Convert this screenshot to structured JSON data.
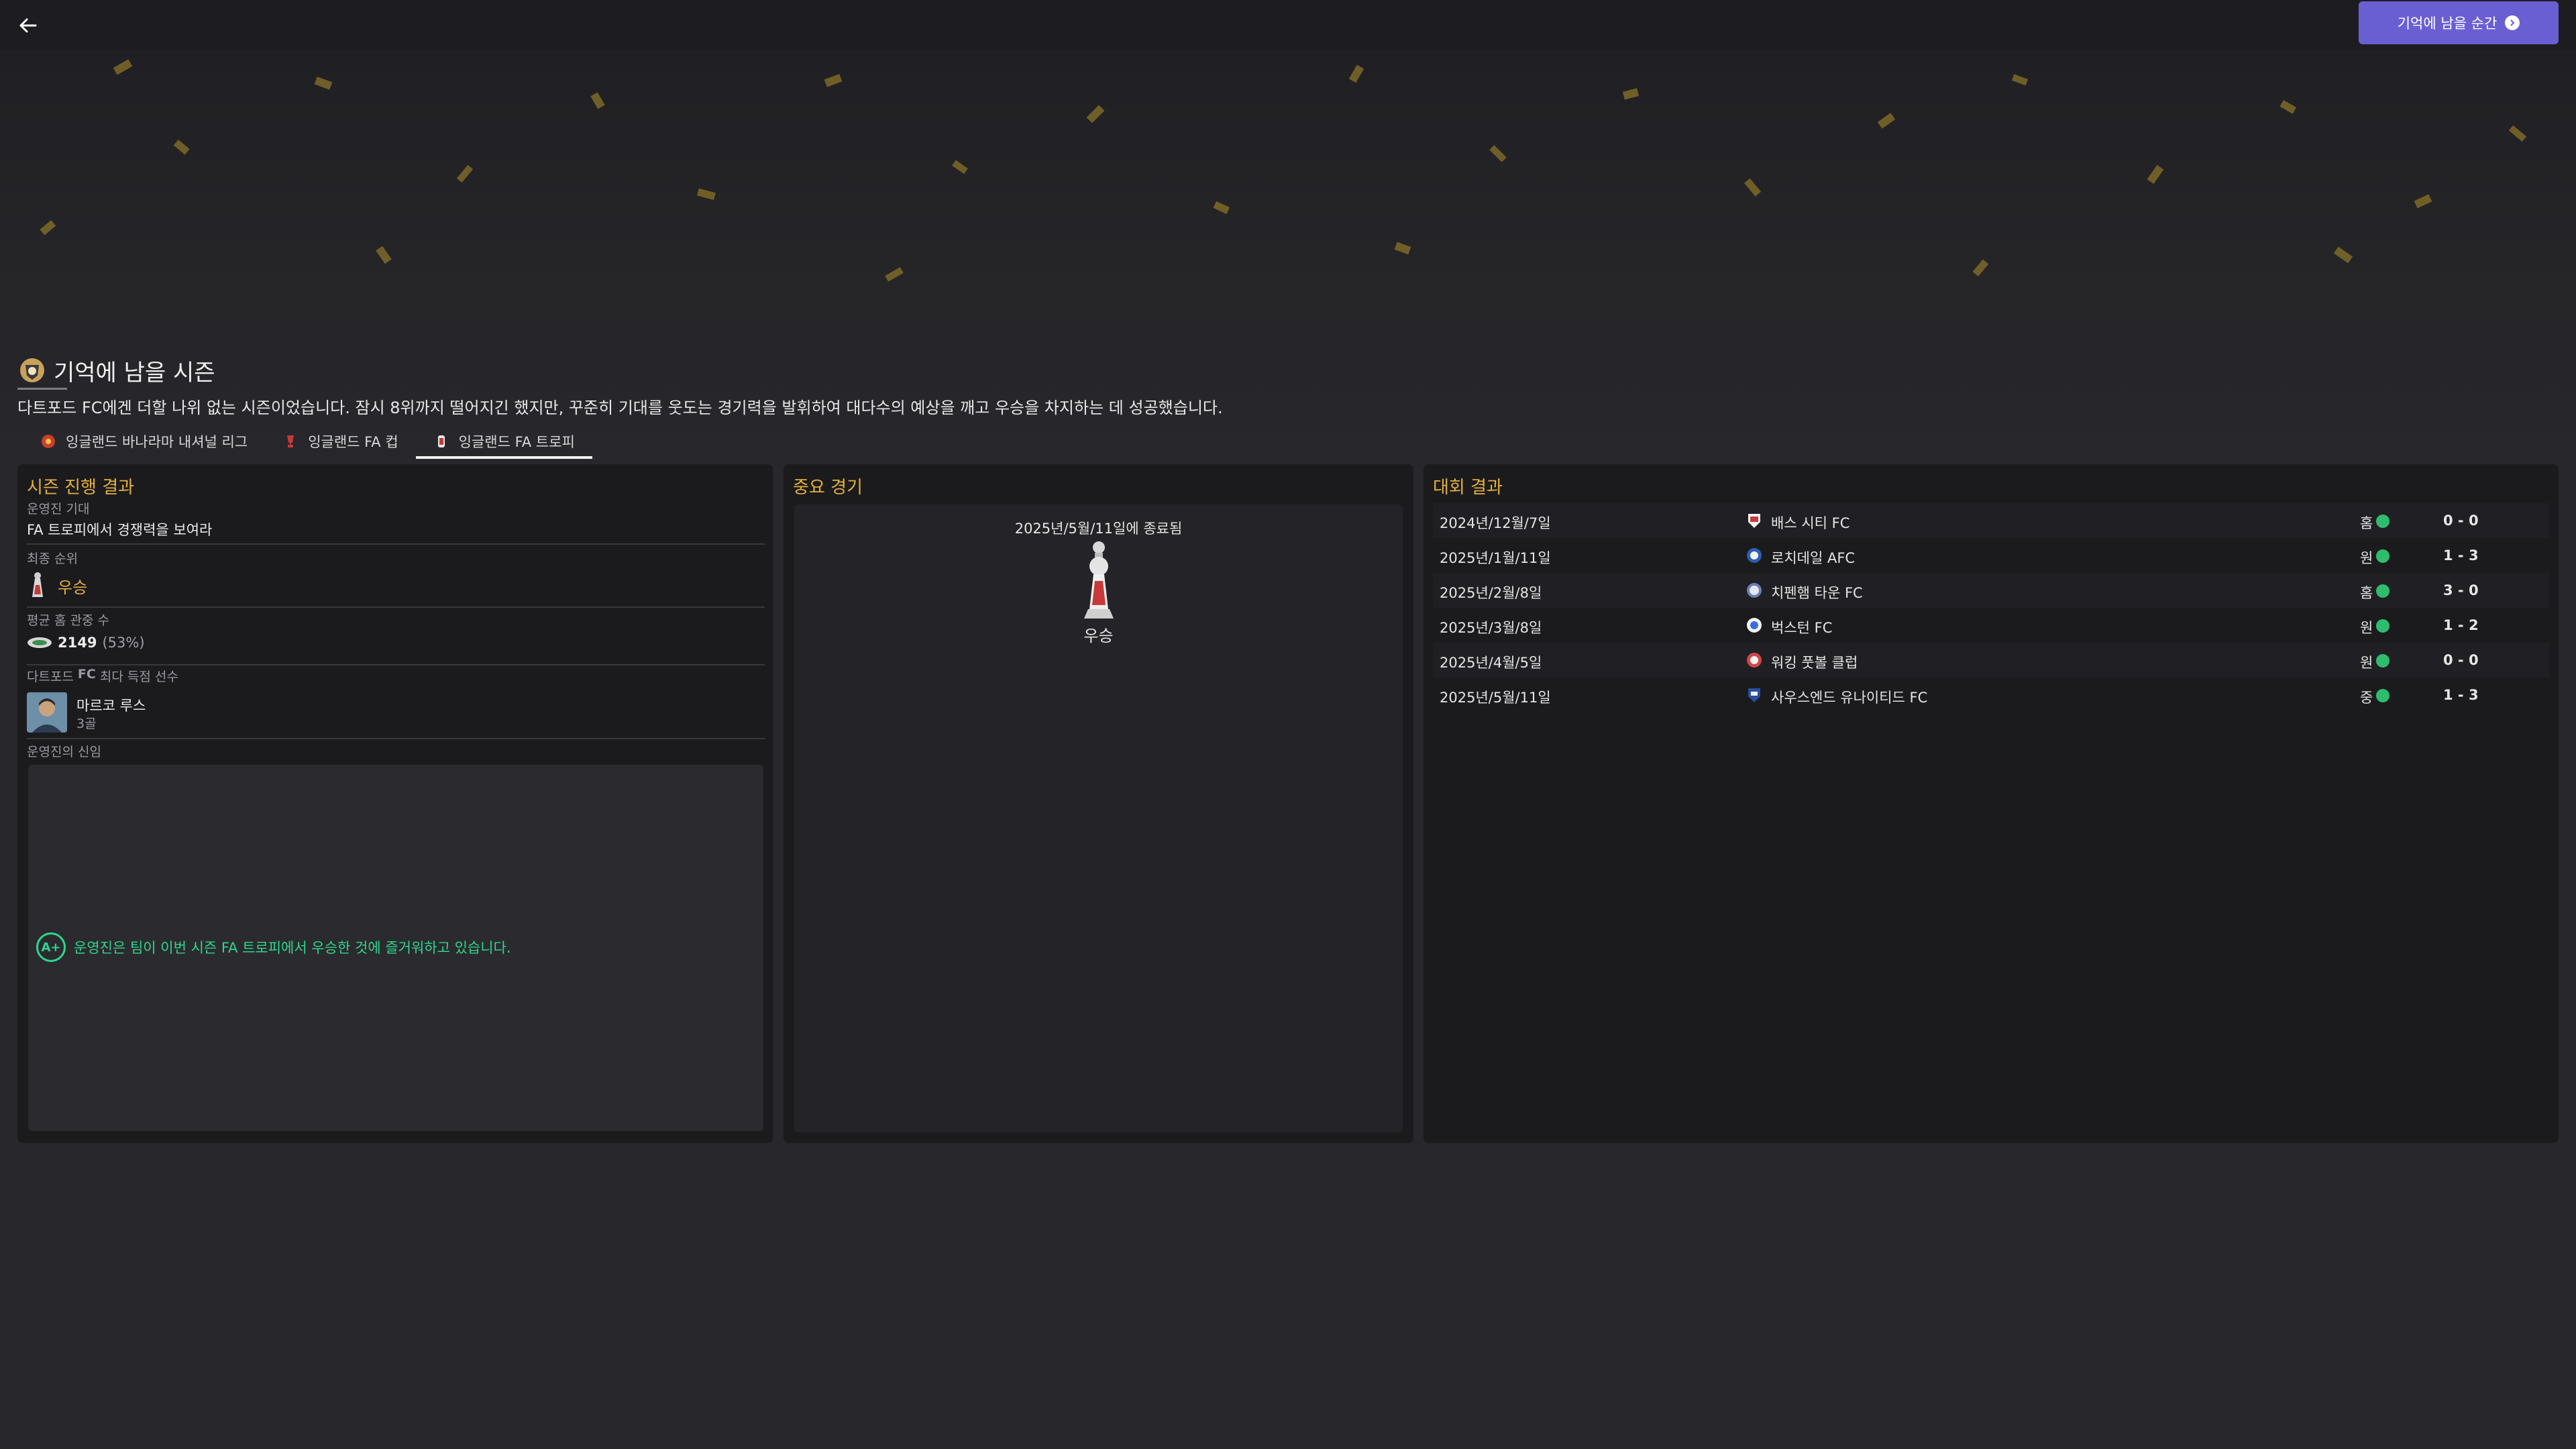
{
  "header": {
    "moment_button": "기억에 남을 순간"
  },
  "season": {
    "title": "기억에 남을 시즌",
    "description": "다트포드 FC에겐 더할 나위 없는 시즌이었습니다. 잠시 8위까지 떨어지긴 했지만, 꾸준히 기대를 웃도는 경기력을 발휘하여 대다수의 예상을 깨고 우승을 차지하는 데 성공했습니다."
  },
  "tabs": [
    {
      "label": "잉글랜드 바나라마 내셔널 리그",
      "active": false
    },
    {
      "label": "잉글랜드 FA 컵",
      "active": false
    },
    {
      "label": "잉글랜드 FA 트로피",
      "active": true
    }
  ],
  "progress": {
    "title": "시즌 진행 결과",
    "board_expectation_label": "운영진 기대",
    "board_expectation_value": "FA 트로피에서 경쟁력을 보여라",
    "final_position_label": "최종 순위",
    "final_position_value": "우승",
    "attendance_label": "평균 홈 관중 수",
    "attendance_value": "2149",
    "attendance_pct": "(53%)",
    "top_scorer_label_prefix": "다트포드",
    "top_scorer_label_fc": "FC",
    "top_scorer_label_suffix": "최다 득점 선수",
    "top_scorer_name": "마르코 루스",
    "top_scorer_goals": "3골",
    "board_confidence_label": "운영진의 신임",
    "grade": "A+",
    "feedback": "운영진은 팀이 이번 시즌 FA 트로피에서 우승한 것에 즐거워하고 있습니다."
  },
  "key_match": {
    "title": "중요 경기",
    "date": "2025년/5월/11일에 종료됨",
    "result": "우승"
  },
  "competition": {
    "title": "대회 결과",
    "rows": [
      {
        "date": "2024년/12월/7일",
        "team": "배스 시티 FC",
        "venue": "홈",
        "score": "0 - 0",
        "crest": "#c9383e"
      },
      {
        "date": "2025년/1월/11일",
        "team": "로치데일 AFC",
        "venue": "원",
        "score": "1 - 3",
        "crest": "#2d5fb0"
      },
      {
        "date": "2025년/2월/8일",
        "team": "치펜햄 타운 FC",
        "venue": "홈",
        "score": "3 - 0",
        "crest": "#6a7fb8"
      },
      {
        "date": "2025년/3월/8일",
        "team": "벅스턴 FC",
        "venue": "원",
        "score": "1 - 2",
        "crest": "#3a6fd8"
      },
      {
        "date": "2025년/4월/5일",
        "team": "워킹 풋볼 클럽",
        "venue": "원",
        "score": "0 - 0",
        "crest": "#d04848"
      },
      {
        "date": "2025년/5월/11일",
        "team": "사우스엔드 유나이티드 FC",
        "venue": "중",
        "score": "1 - 3",
        "crest": "#2a4ea0"
      }
    ]
  }
}
